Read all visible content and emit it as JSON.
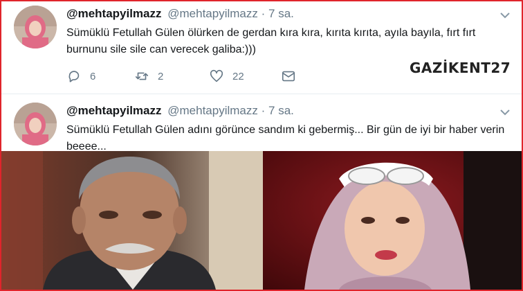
{
  "tweets": [
    {
      "display_name": "@mehtapyilmazz",
      "handle": "@mehtapyilmazz",
      "separator": "·",
      "time": "7 sa.",
      "text": "Sümüklü Fetullah Gülen ölürken de gerdan kıra kıra, kırıta kırıta, ayıla bayıla, fırt fırt burnunu sile sile can verecek galiba:)))",
      "actions": {
        "replies": "6",
        "retweets": "2",
        "likes": "22"
      }
    },
    {
      "display_name": "@mehtapyilmazz",
      "handle": "@mehtapyilmazz",
      "separator": "·",
      "time": "7 sa.",
      "text": "Sümüklü Fetullah Gülen adını görünce sandım ki gebermiş... Bir gün de iyi bir haber verin beeee..."
    }
  ],
  "watermark": {
    "text": "GAZİKENT27"
  },
  "icons": {
    "reply": "reply-icon",
    "retweet": "retweet-icon",
    "like": "heart-icon",
    "dm": "envelope-icon",
    "caret": "chevron-down-icon"
  },
  "colors": {
    "border": "#e0242b",
    "muted": "#657786",
    "text": "#14171a"
  }
}
